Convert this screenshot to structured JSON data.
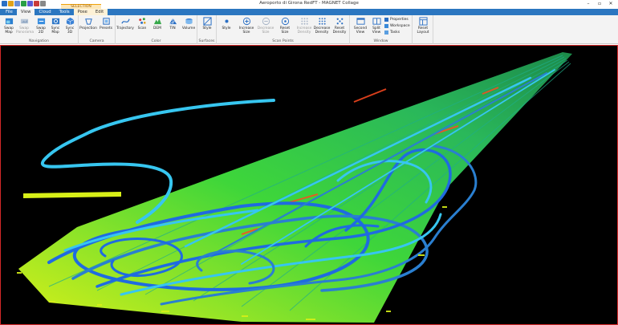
{
  "window": {
    "title": "Aeroporto di Girona RedFT - MAGNET Collage",
    "controls": {
      "minimize": "–",
      "restore": "▫",
      "close": "✕"
    }
  },
  "quick_access": [
    {
      "name": "save",
      "color": "#2a6fc4"
    },
    {
      "name": "open",
      "color": "#e0a21a"
    },
    {
      "name": "undo",
      "color": "#6a8fd6"
    },
    {
      "name": "redo",
      "color": "#2a9f46"
    },
    {
      "name": "help",
      "color": "#5b5bd6"
    },
    {
      "name": "customize",
      "color": "#c83b3b"
    },
    {
      "name": "more",
      "color": "#888888"
    }
  ],
  "contextual_tab_header": "SELECTION",
  "tabs": [
    {
      "label": "File",
      "state": "normal"
    },
    {
      "label": "View",
      "state": "active"
    },
    {
      "label": "Cloud",
      "state": "normal"
    },
    {
      "label": "Tools",
      "state": "normal"
    },
    {
      "label": "Pose",
      "state": "ctx"
    },
    {
      "label": "Edit",
      "state": "ctx"
    }
  ],
  "ribbon": {
    "groups": {
      "navigation": "Navigation",
      "camera": "Camera",
      "color": "Color",
      "surfaces": "Surfaces",
      "scan_points": "Scan Points",
      "window": "Window"
    },
    "buttons": {
      "swap_map": "Swap\nMap",
      "swap_panorama": "Swap\nPanorama",
      "swap_2d": "Swap\n2D",
      "sync_map": "Sync\nMap",
      "sync_3d": "Sync\n3D",
      "projection": "Projection",
      "presets": "Presets",
      "trajectory": "Trajectory",
      "scan": "Scan",
      "dem": "DEM",
      "tin": "TIN",
      "volume": "Volume",
      "style_surfaces": "Style",
      "style_points": "Style",
      "increase_size": "Increase\nSize",
      "decrease_size": "Decrease\nSize",
      "reset_size": "Reset\nSize",
      "increase_density": "Increase\nDensity",
      "decrease_density": "Decrease\nDensity",
      "reset_density": "Reset\nDensity",
      "second_view": "Second\nView",
      "split_view": "Split\nView",
      "properties": "Properties",
      "workspace": "Workspace",
      "tasks": "Tasks",
      "reset_layout": "Reset\nLayout"
    }
  },
  "colors": {
    "tab_bar": "#2b76c0",
    "ribbon_bg": "#f3f3f3",
    "viewport_bg": "#000000",
    "viewport_border": "#d32828",
    "cloud_yellow": "#d8f018",
    "cloud_green": "#3ed63a",
    "trajectory_blue": "#1f6be0",
    "trajectory_cyan": "#37c6f0",
    "hotspot_red": "#ff4a20"
  }
}
